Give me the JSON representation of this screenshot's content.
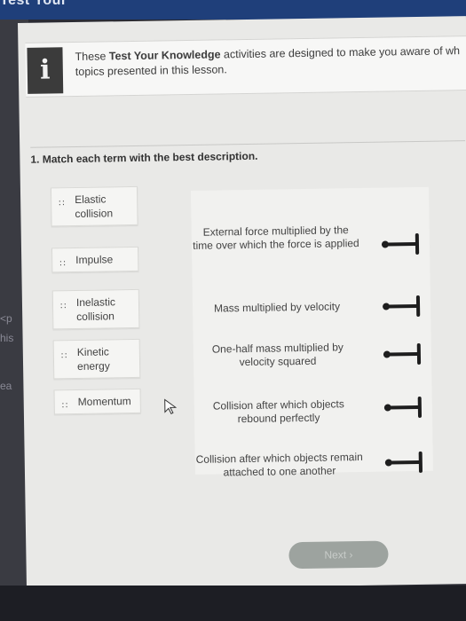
{
  "header": {
    "partial_title": "Test Your"
  },
  "left_edge_fragments": [
    "<p",
    "his",
    "ea"
  ],
  "info_banner": {
    "icon": "info-icon",
    "icon_glyph": "i",
    "text_before": "These ",
    "text_bold": "Test Your Knowledge",
    "text_after": " activities are designed to make you aware of wh",
    "text_line2": "topics presented in this lesson."
  },
  "question": {
    "text": "1. Match each term with the best description."
  },
  "terms": [
    {
      "label": "Elastic collision"
    },
    {
      "label": "Impulse"
    },
    {
      "label": "Inelastic collision"
    },
    {
      "label": "Kinetic energy"
    },
    {
      "label": "Momentum"
    }
  ],
  "descriptions": [
    {
      "text": "External force multiplied by the time over which the force is applied"
    },
    {
      "text": "Mass multiplied by velocity"
    },
    {
      "text": "One-half mass multiplied by velocity squared"
    },
    {
      "text": "Collision after which objects rebound perfectly"
    },
    {
      "text": "Collision after which objects remain attached to one another"
    }
  ],
  "next_button": {
    "label": "Next",
    "arrow": "›",
    "state": "disabled"
  },
  "colors": {
    "top_bar": "#1f3f7a",
    "screen_bg": "#e9e9e7",
    "info_icon_bg": "#3b3b3b",
    "slot_color": "#1e1e1e",
    "next_button_bg": "#9da39f"
  }
}
